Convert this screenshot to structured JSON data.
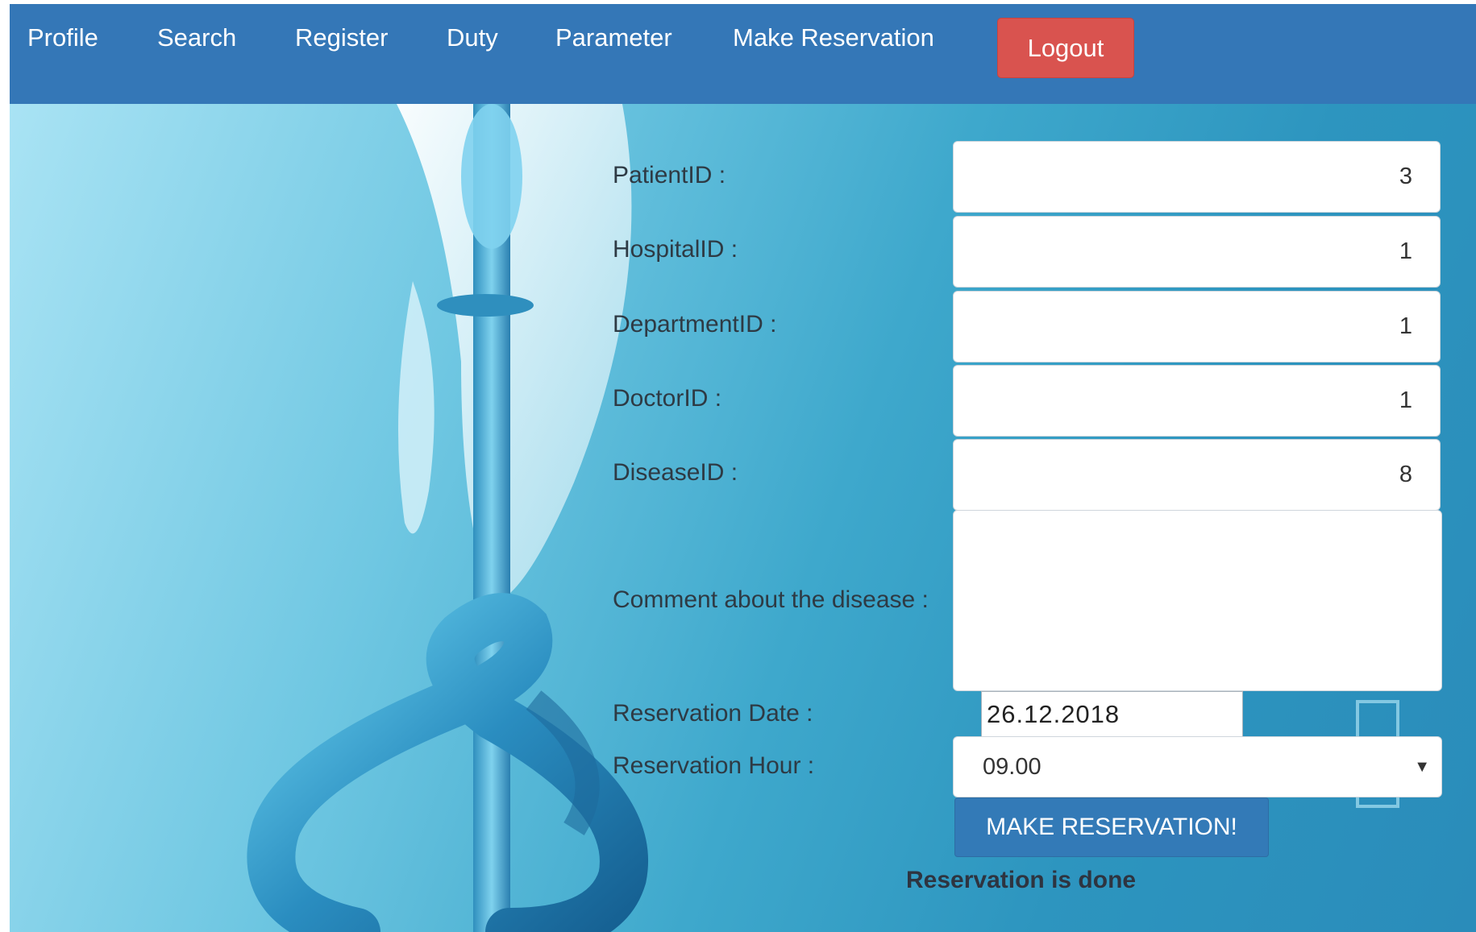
{
  "navbar": {
    "links": [
      {
        "label": "Profile"
      },
      {
        "label": "Search"
      },
      {
        "label": "Register"
      },
      {
        "label": "Duty"
      },
      {
        "label": "Parameter"
      },
      {
        "label": "Make Reservation"
      }
    ],
    "logout_label": "Logout",
    "background_color": "#3477b7",
    "logout_color": "#d9534f"
  },
  "form": {
    "patient_id": {
      "label": "PatientID :",
      "value": "3"
    },
    "hospital_id": {
      "label": "HospitalID :",
      "value": "1"
    },
    "department_id": {
      "label": "DepartmentID :",
      "value": "1"
    },
    "doctor_id": {
      "label": "DoctorID :",
      "value": "1"
    },
    "disease_id": {
      "label": "DiseaseID :",
      "value": "8"
    },
    "comment": {
      "label": "Comment about the disease :",
      "value": ""
    },
    "reservation_date": {
      "label": "Reservation Date :",
      "value": "26.12.2018"
    },
    "reservation_hour": {
      "label": "Reservation Hour :",
      "value": "09.00"
    },
    "submit_label": "MAKE RESERVATION!",
    "status_message": "Reservation is done"
  },
  "icons": {
    "select_caret": "▼"
  }
}
